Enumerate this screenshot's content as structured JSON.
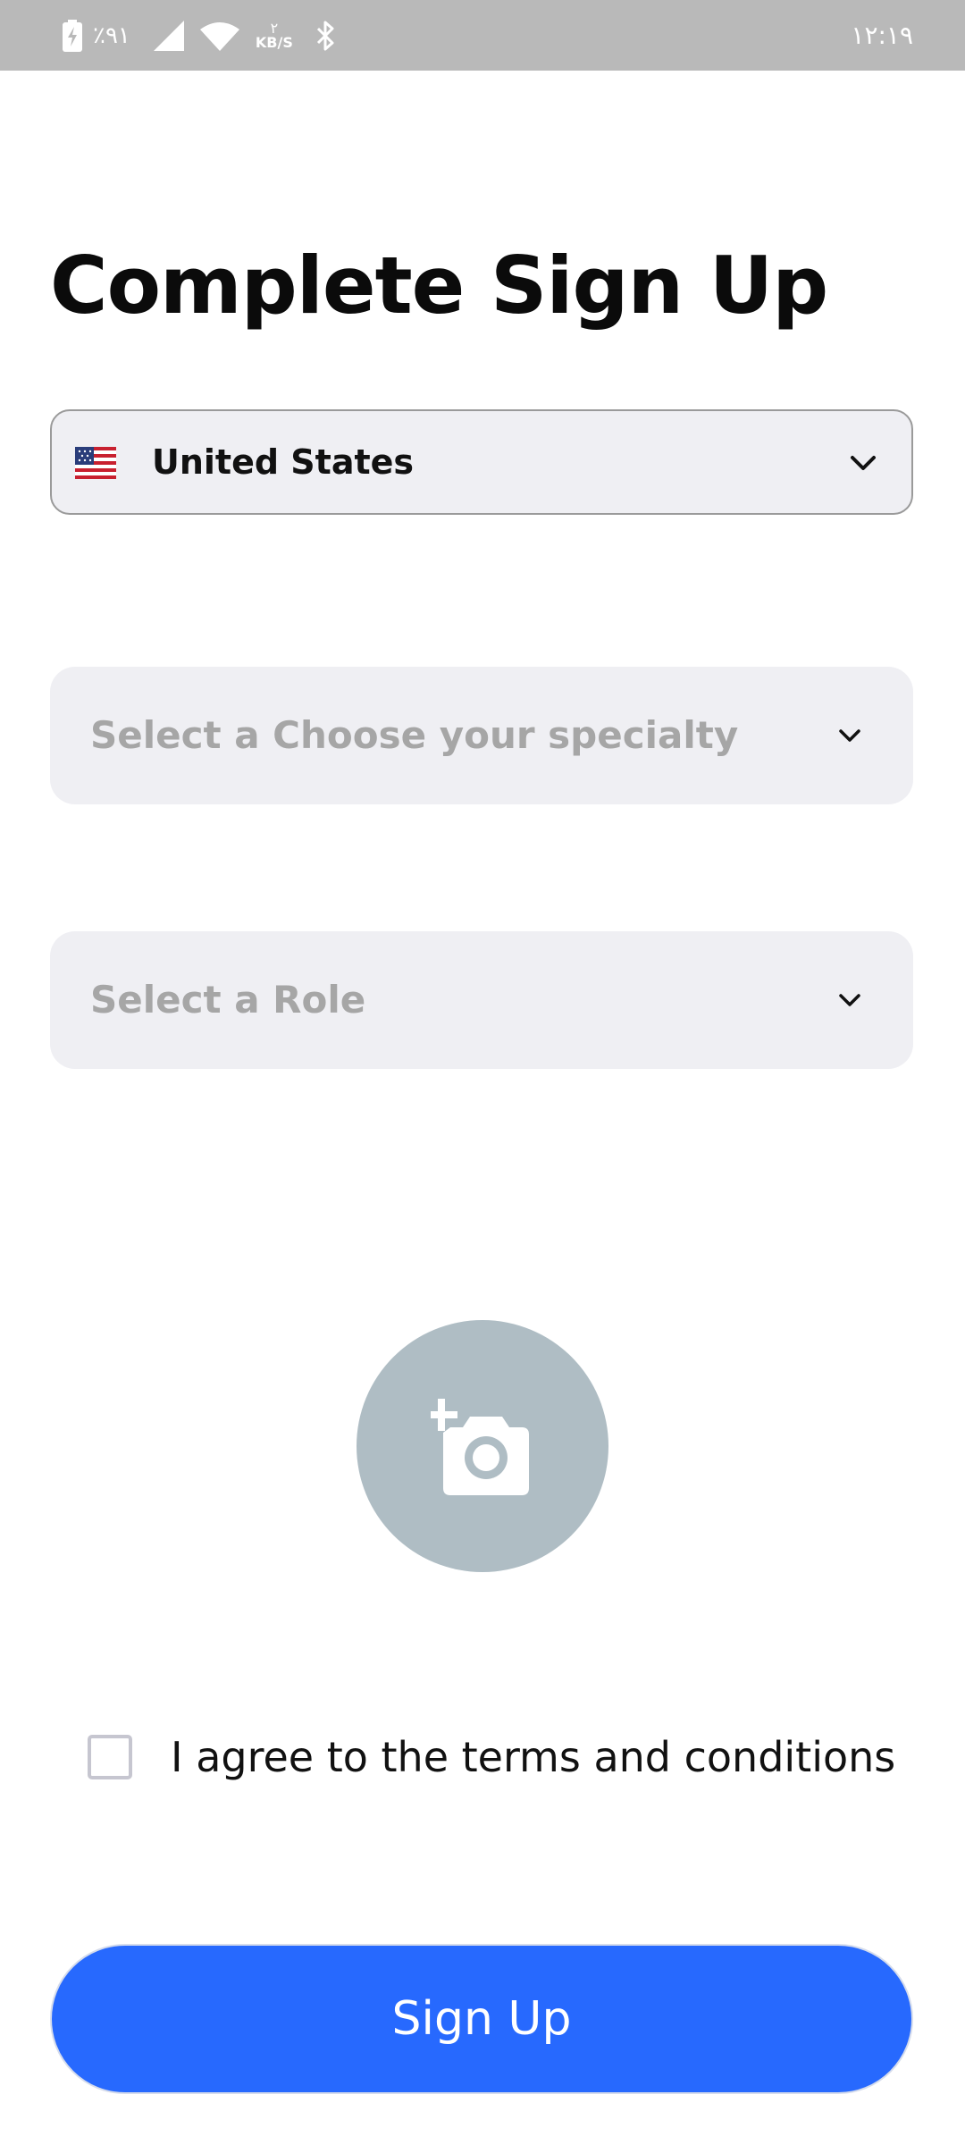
{
  "status_bar": {
    "battery_text": "٪۹۱",
    "speed_number": "۲",
    "speed_unit": "KB/S",
    "time": "۱۲:۱۹"
  },
  "title": "Complete Sign Up",
  "country_select": {
    "flag_icon": "us-flag-icon",
    "value": "United States",
    "chevron_icon": "chevron-down-icon"
  },
  "specialty_select": {
    "placeholder": "Select a Choose your specialty",
    "chevron_icon": "chevron-down-icon"
  },
  "role_select": {
    "placeholder": "Select a Role",
    "chevron_icon": "chevron-down-icon"
  },
  "avatar_upload": {
    "icon": "camera-add-icon",
    "background_color": "#afbdc4"
  },
  "terms": {
    "checked": false,
    "label": "I agree to the terms and conditions"
  },
  "signup_button": {
    "label": "Sign Up",
    "color": "#2769fe"
  }
}
